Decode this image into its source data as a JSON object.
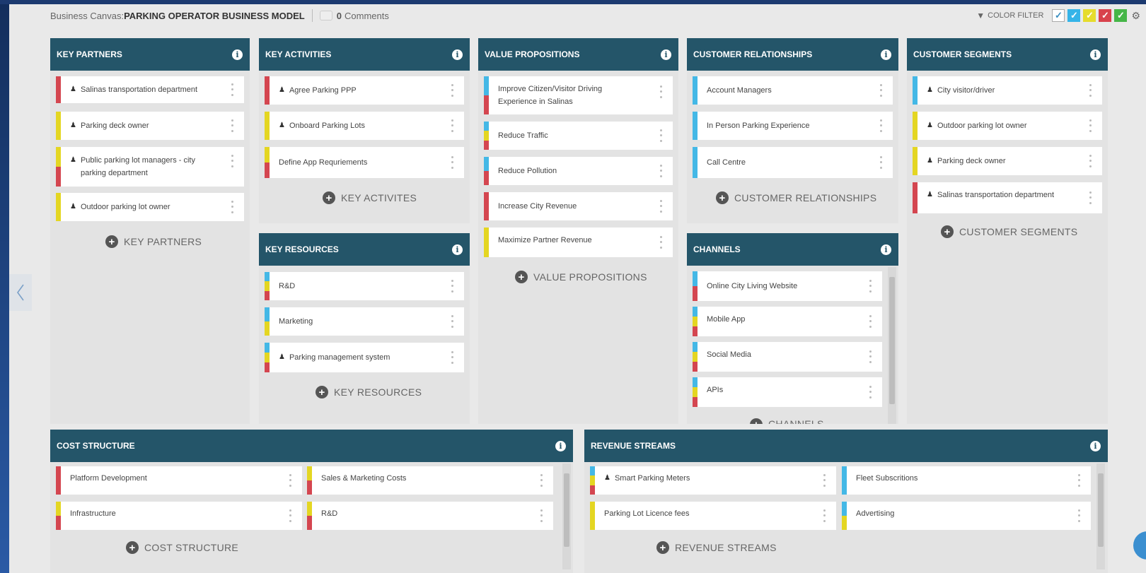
{
  "header": {
    "canvas_label": "Business Canvas:",
    "canvas_name": "PARKING OPERATOR BUSINESS MODEL",
    "comments_count": "0",
    "comments_label": "Comments"
  },
  "filter": {
    "label": "COLOR FILTER",
    "checkboxes": [
      {
        "color": "#ffffff",
        "checked": true
      },
      {
        "color": "#35b4e8"
      },
      {
        "color": "#e6dc2c"
      },
      {
        "color": "#d8424c"
      },
      {
        "color": "#46b648"
      }
    ]
  },
  "colors": {
    "blue": "#44b8e6",
    "yellow": "#e4d622",
    "red": "#d44650",
    "header": "#245569"
  },
  "key_partners": {
    "title": "KEY PARTNERS",
    "add_label": "KEY PARTNERS",
    "items": [
      {
        "text": "Salinas transportation department"
      },
      {
        "text": "Parking deck owner"
      },
      {
        "text": "Public parking lot managers - city parking department"
      },
      {
        "text": "Outdoor parking lot owner"
      }
    ]
  },
  "key_activities": {
    "title": "KEY ACTIVITIES",
    "add_label": "KEY ACTIVITES",
    "items": [
      {
        "text": "Agree Parking PPP"
      },
      {
        "text": "Onboard Parking Lots"
      },
      {
        "text": "Define App Requriements"
      }
    ]
  },
  "key_resources": {
    "title": "KEY RESOURCES",
    "add_label": "KEY RESOURCES",
    "items": [
      {
        "text": "R&D"
      },
      {
        "text": "Marketing"
      },
      {
        "text": "Parking management system"
      }
    ]
  },
  "value_propositions": {
    "title": "VALUE PROPOSITIONS",
    "add_label": "VALUE PROPOSITIONS",
    "items": [
      {
        "text": "Improve Citizen/Visitor Driving Experience in Salinas"
      },
      {
        "text": "Reduce Traffic"
      },
      {
        "text": "Reduce Pollution"
      },
      {
        "text": "Increase City Revenue"
      },
      {
        "text": "Maximize Partner Revenue"
      }
    ]
  },
  "customer_relationships": {
    "title": "CUSTOMER RELATIONSHIPS",
    "add_label": "CUSTOMER RELATIONSHIPS",
    "items": [
      {
        "text": "Account Managers"
      },
      {
        "text": "In Person Parking Experience"
      },
      {
        "text": "Call Centre"
      }
    ]
  },
  "channels": {
    "title": "CHANNELS",
    "add_label": "CHANNELS",
    "items": [
      {
        "text": "Online City Living Website"
      },
      {
        "text": "Mobile App"
      },
      {
        "text": "Social Media"
      },
      {
        "text": "APIs"
      }
    ]
  },
  "customer_segments": {
    "title": "CUSTOMER SEGMENTS",
    "add_label": "CUSTOMER SEGMENTS",
    "items": [
      {
        "text": "City visitor/driver"
      },
      {
        "text": "Outdoor parking lot owner"
      },
      {
        "text": "Parking deck owner"
      },
      {
        "text": "Salinas transportation department"
      }
    ]
  },
  "cost_structure": {
    "title": "COST STRUCTURE",
    "add_label": "COST STRUCTURE",
    "items": [
      {
        "text": "Platform Development"
      },
      {
        "text": "Sales & Marketing Costs"
      },
      {
        "text": "Infrastructure"
      },
      {
        "text": "R&D"
      }
    ]
  },
  "revenue_streams": {
    "title": "REVENUE STREAMS",
    "add_label": "REVENUE STREAMS",
    "items": [
      {
        "text": "Smart Parking Meters"
      },
      {
        "text": "Fleet Subscritions"
      },
      {
        "text": "Parking Lot Licence fees"
      },
      {
        "text": "Advertising"
      }
    ]
  }
}
